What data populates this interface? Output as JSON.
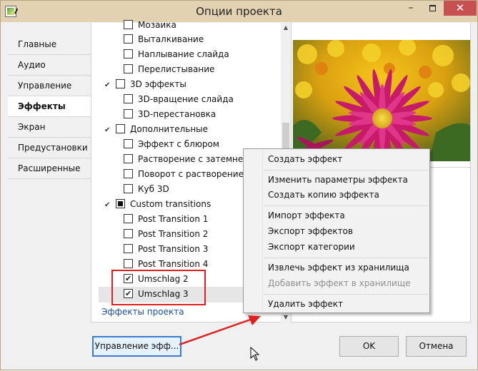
{
  "window": {
    "title": "Опции проекта",
    "min_glyph": "–",
    "close_glyph": "✕"
  },
  "sidebar": {
    "items": [
      {
        "label": "Главные",
        "active": false
      },
      {
        "label": "Аудио",
        "active": false
      },
      {
        "label": "Управление",
        "active": false
      },
      {
        "label": "Эффекты",
        "active": true
      },
      {
        "label": "Экран",
        "active": false
      },
      {
        "label": "Предустановки",
        "active": false
      },
      {
        "label": "Расширенные",
        "active": false
      }
    ]
  },
  "tree": {
    "rows": [
      {
        "label": "Мозаика",
        "level": 1,
        "state": "unchecked"
      },
      {
        "label": "Выталкивание",
        "level": 1,
        "state": "unchecked"
      },
      {
        "label": "Наплывание слайда",
        "level": 1,
        "state": "unchecked"
      },
      {
        "label": "Перелистывание",
        "level": 1,
        "state": "unchecked"
      },
      {
        "label": "3D эффекты",
        "level": 0,
        "state": "unchecked"
      },
      {
        "label": "3D-вращение слайда",
        "level": 1,
        "state": "unchecked"
      },
      {
        "label": "3D-перестановка",
        "level": 1,
        "state": "unchecked"
      },
      {
        "label": "Дополнительные",
        "level": 0,
        "state": "unchecked"
      },
      {
        "label": "Эффект с блюром",
        "level": 1,
        "state": "unchecked"
      },
      {
        "label": "Растворение с затемнением",
        "level": 1,
        "state": "unchecked"
      },
      {
        "label": "Поворот с растворением",
        "level": 1,
        "state": "unchecked"
      },
      {
        "label": "Куб 3D",
        "level": 1,
        "state": "unchecked"
      },
      {
        "label": "Custom transitions",
        "level": 0,
        "state": "partial"
      },
      {
        "label": "Post Transition 1",
        "level": 1,
        "state": "unchecked"
      },
      {
        "label": "Post Transition 2",
        "level": 1,
        "state": "unchecked"
      },
      {
        "label": "Post Transition 3",
        "level": 1,
        "state": "unchecked"
      },
      {
        "label": "Post Transition 4",
        "level": 1,
        "state": "unchecked"
      },
      {
        "label": "Umschlag 2",
        "level": 1,
        "state": "checked"
      },
      {
        "label": "Umschlag 3",
        "level": 1,
        "state": "checked"
      }
    ],
    "chevron_glyph": "✔",
    "selected_item": "Umschlag 3",
    "effects_link": "Эффекты проекта"
  },
  "context_menu": {
    "items": [
      {
        "label": "Создать эффект",
        "disabled": false
      },
      {
        "label": "Изменить параметры эффекта",
        "disabled": false
      },
      {
        "label": "Создать копию эффекта",
        "disabled": false
      },
      {
        "label": "Импорт эффекта",
        "disabled": false
      },
      {
        "label": "Экспорт эффектов",
        "disabled": false
      },
      {
        "label": "Экспорт категории",
        "disabled": false
      },
      {
        "label": "Извлечь эффект из хранилища",
        "disabled": false
      },
      {
        "label": "Добавить эффект в хранилище",
        "disabled": true
      },
      {
        "label": "Удалить эффект",
        "disabled": false
      }
    ]
  },
  "buttons": {
    "manage": "Управление эфф...",
    "ok": "OK",
    "cancel": "Отмена"
  },
  "colors": {
    "titlebar": "#e3d2b2",
    "close": "#c75050",
    "annotation": "#e02020",
    "focus": "#3d7bd0"
  }
}
